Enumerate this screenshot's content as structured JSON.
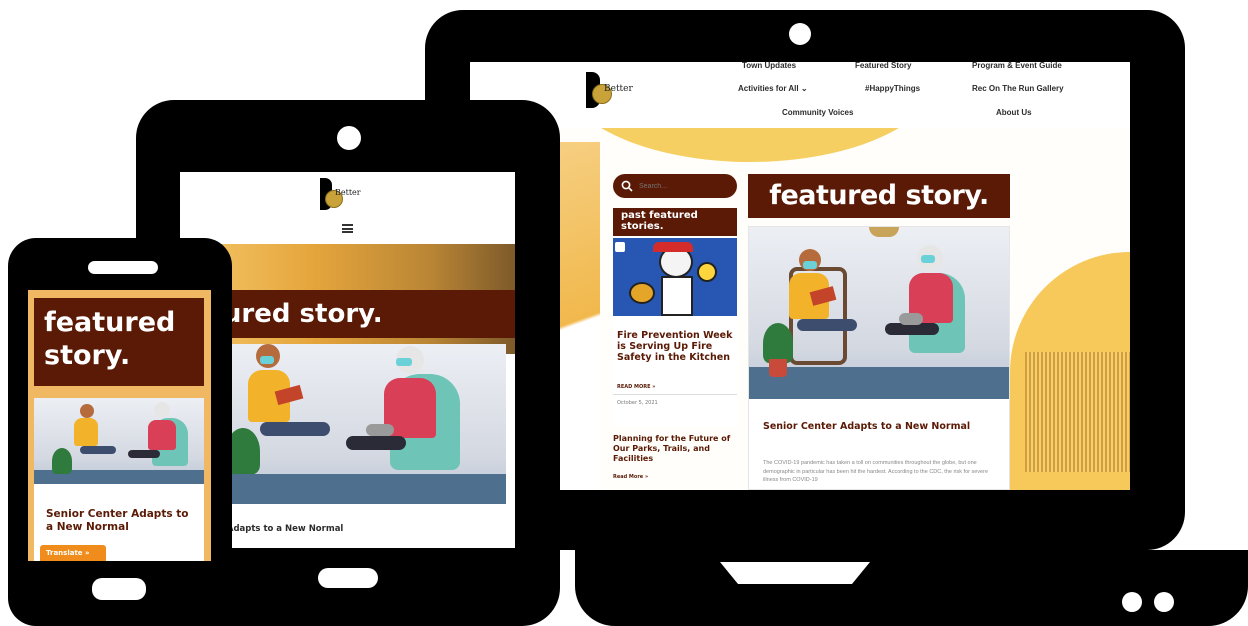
{
  "laptop": {
    "logo_text": "Better",
    "nav": {
      "town_updates": "Town Updates",
      "featured_story": "Featured Story",
      "program_guide": "Program & Event Guide",
      "activities": "Activities for All",
      "activities_caret": "⌄",
      "happy_things": "#HappyThings",
      "rec_gallery": "Rec On The Run Gallery",
      "community_voices": "Community Voices",
      "about_us": "About Us"
    },
    "search": {
      "placeholder": "Search..."
    },
    "sidebar": {
      "title": "past featured stories.",
      "post1_title": "Fire Prevention Week is Serving Up Fire Safety in the Kitchen",
      "post1_read_more": "READ MORE »",
      "post1_date": "October 5, 2021",
      "post2_title": "Planning for the Future of Our Parks, Trails, and Facilities",
      "post2_read_more": "Read More »"
    },
    "main": {
      "heading": "featured story.",
      "article_title": "Senior Center Adapts to a New Normal",
      "article_excerpt": "The COVID-19 pandemic has taken a toll on communities throughout the globe, but one demographic in particular has been hit the hardest. According to the CDC, the risk for severe illness from COVID-19"
    }
  },
  "tablet": {
    "logo_text": "Better",
    "menu_icon": "hamburger-icon",
    "heading": "featured story.",
    "article_title": "Senior Center Adapts to a New Normal"
  },
  "phone": {
    "heading": "featured story.",
    "article_title": "Senior Center Adapts to a New Normal",
    "translate_button": "Translate »"
  },
  "colors": {
    "brand_brown": "#5a1a05",
    "accent_yellow": "#f3c34d",
    "translate_orange": "#f08c1c"
  }
}
